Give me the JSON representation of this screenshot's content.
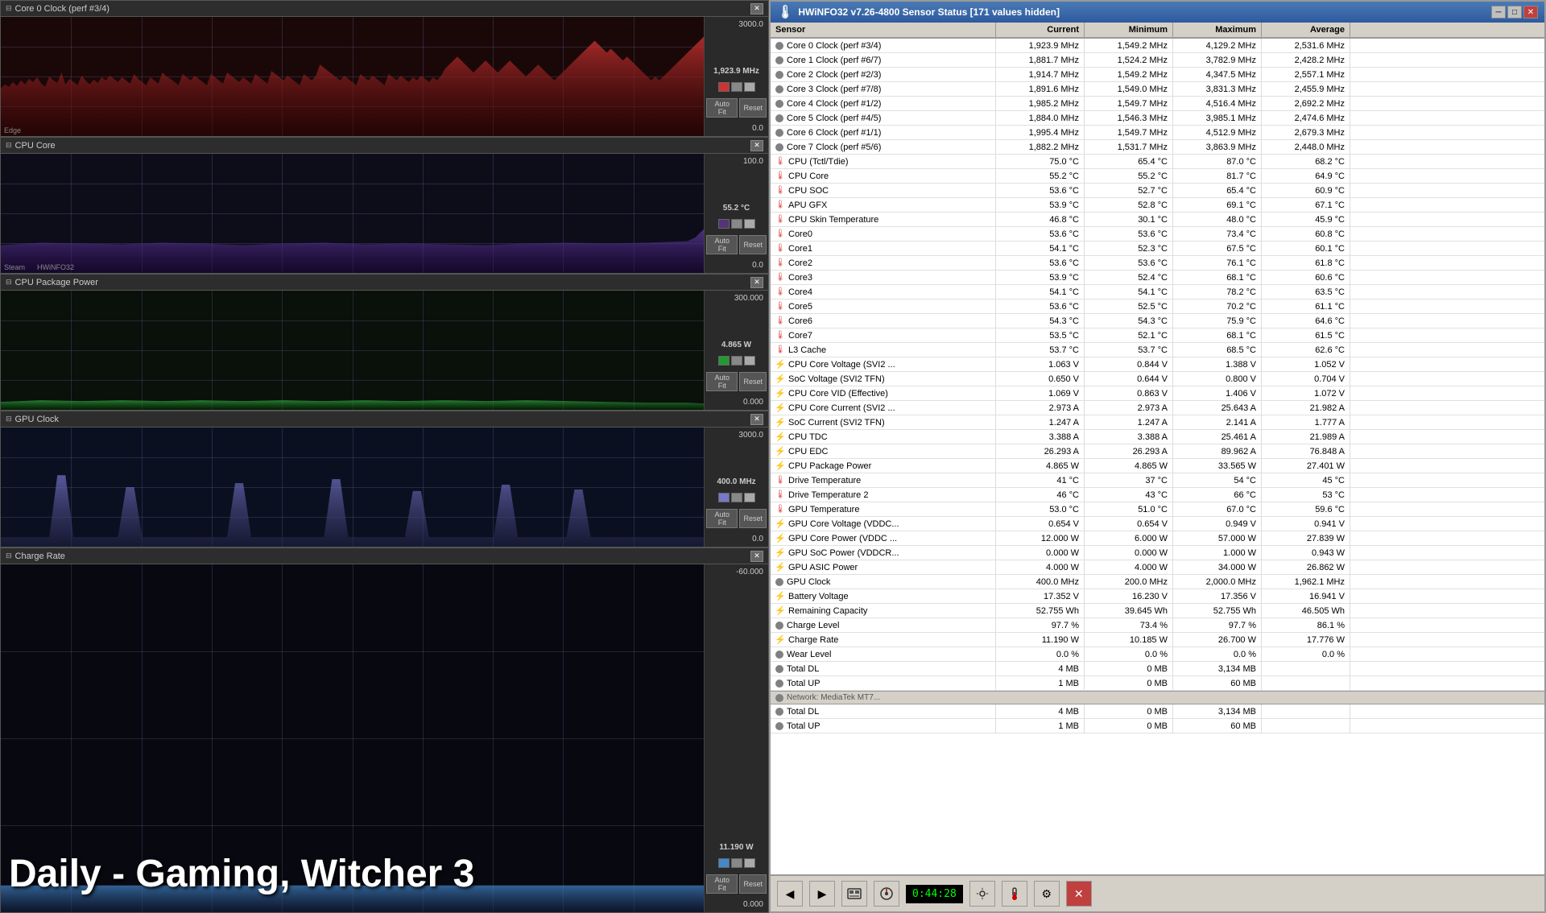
{
  "left_panel": {
    "charts": [
      {
        "id": "core0-clock",
        "title": "Core 0 Clock (perf #3/4)",
        "max_label": "3000.0",
        "current_label": "1,923.9 MHz",
        "min_label": "0.0",
        "color1": "#cc3333",
        "color2": "#888888",
        "color3": "#aaaaaa",
        "chart_type": "red_noisy"
      },
      {
        "id": "cpu-core",
        "title": "CPU Core",
        "max_label": "100.0",
        "current_label": "55.2 °C",
        "min_label": "0.0",
        "color1": "#553377",
        "color2": "#888888",
        "color3": "#aaaaaa",
        "chart_type": "purple_flat"
      },
      {
        "id": "cpu-power",
        "title": "CPU Package Power",
        "max_label": "300.000",
        "current_label": "4.865 W",
        "min_label": "0.000",
        "color1": "#229933",
        "color2": "#888888",
        "color3": "#aaaaaa",
        "chart_type": "green_flat"
      },
      {
        "id": "gpu-clock",
        "title": "GPU Clock",
        "max_label": "3000.0",
        "current_label": "400.0 MHz",
        "min_label": "0.0",
        "color1": "#7777cc",
        "color2": "#888888",
        "color3": "#aaaaaa",
        "chart_type": "blue_spiky"
      },
      {
        "id": "charge-rate",
        "title": "Charge Rate",
        "max_label": "-60.000",
        "current_label": "11.190 W",
        "min_label": "0.000",
        "color1": "#4488cc",
        "color2": "#888888",
        "color3": "#aaaaaa",
        "chart_type": "blue_flat"
      }
    ]
  },
  "bottom_text": "Daily - Gaming, Witcher 3",
  "taskbar": {
    "label1": "Edge",
    "label2": "Steam",
    "label3": "HWiNFO32"
  },
  "right_panel": {
    "title": "HWiNFO32 v7.26-4800 Sensor Status [171 values hidden]",
    "headers": [
      "Sensor",
      "Current",
      "Minimum",
      "Maximum",
      "Average"
    ],
    "rows": [
      {
        "icon": "circle",
        "name": "Core 0 Clock (perf #3/4)",
        "current": "1,923.9 MHz",
        "min": "1,549.2 MHz",
        "max": "4,129.2 MHz",
        "avg": "2,531.6 MHz"
      },
      {
        "icon": "circle",
        "name": "Core 1 Clock (perf #6/7)",
        "current": "1,881.7 MHz",
        "min": "1,524.2 MHz",
        "max": "3,782.9 MHz",
        "avg": "2,428.2 MHz"
      },
      {
        "icon": "circle",
        "name": "Core 2 Clock (perf #2/3)",
        "current": "1,914.7 MHz",
        "min": "1,549.2 MHz",
        "max": "4,347.5 MHz",
        "avg": "2,557.1 MHz"
      },
      {
        "icon": "circle",
        "name": "Core 3 Clock (perf #7/8)",
        "current": "1,891.6 MHz",
        "min": "1,549.0 MHz",
        "max": "3,831.3 MHz",
        "avg": "2,455.9 MHz"
      },
      {
        "icon": "circle",
        "name": "Core 4 Clock (perf #1/2)",
        "current": "1,985.2 MHz",
        "min": "1,549.7 MHz",
        "max": "4,516.4 MHz",
        "avg": "2,692.2 MHz"
      },
      {
        "icon": "circle",
        "name": "Core 5 Clock (perf #4/5)",
        "current": "1,884.0 MHz",
        "min": "1,546.3 MHz",
        "max": "3,985.1 MHz",
        "avg": "2,474.6 MHz"
      },
      {
        "icon": "circle",
        "name": "Core 6 Clock (perf #1/1)",
        "current": "1,995.4 MHz",
        "min": "1,549.7 MHz",
        "max": "4,512.9 MHz",
        "avg": "2,679.3 MHz"
      },
      {
        "icon": "circle",
        "name": "Core 7 Clock (perf #5/6)",
        "current": "1,882.2 MHz",
        "min": "1,531.7 MHz",
        "max": "3,863.9 MHz",
        "avg": "2,448.0 MHz"
      },
      {
        "icon": "thermo",
        "name": "CPU (Tctl/Tdie)",
        "current": "75.0 °C",
        "min": "65.4 °C",
        "max": "87.0 °C",
        "avg": "68.2 °C"
      },
      {
        "icon": "thermo",
        "name": "CPU Core",
        "current": "55.2 °C",
        "min": "55.2 °C",
        "max": "81.7 °C",
        "avg": "64.9 °C"
      },
      {
        "icon": "thermo",
        "name": "CPU SOC",
        "current": "53.6 °C",
        "min": "52.7 °C",
        "max": "65.4 °C",
        "avg": "60.9 °C"
      },
      {
        "icon": "thermo",
        "name": "APU GFX",
        "current": "53.9 °C",
        "min": "52.8 °C",
        "max": "69.1 °C",
        "avg": "67.1 °C"
      },
      {
        "icon": "thermo",
        "name": "CPU Skin Temperature",
        "current": "46.8 °C",
        "min": "30.1 °C",
        "max": "48.0 °C",
        "avg": "45.9 °C"
      },
      {
        "icon": "thermo",
        "name": "Core0",
        "current": "53.6 °C",
        "min": "53.6 °C",
        "max": "73.4 °C",
        "avg": "60.8 °C"
      },
      {
        "icon": "thermo",
        "name": "Core1",
        "current": "54.1 °C",
        "min": "52.3 °C",
        "max": "67.5 °C",
        "avg": "60.1 °C"
      },
      {
        "icon": "thermo",
        "name": "Core2",
        "current": "53.6 °C",
        "min": "53.6 °C",
        "max": "76.1 °C",
        "avg": "61.8 °C"
      },
      {
        "icon": "thermo",
        "name": "Core3",
        "current": "53.9 °C",
        "min": "52.4 °C",
        "max": "68.1 °C",
        "avg": "60.6 °C"
      },
      {
        "icon": "thermo",
        "name": "Core4",
        "current": "54.1 °C",
        "min": "54.1 °C",
        "max": "78.2 °C",
        "avg": "63.5 °C"
      },
      {
        "icon": "thermo",
        "name": "Core5",
        "current": "53.6 °C",
        "min": "52.5 °C",
        "max": "70.2 °C",
        "avg": "61.1 °C"
      },
      {
        "icon": "thermo",
        "name": "Core6",
        "current": "54.3 °C",
        "min": "54.3 °C",
        "max": "75.9 °C",
        "avg": "64.6 °C"
      },
      {
        "icon": "thermo",
        "name": "Core7",
        "current": "53.5 °C",
        "min": "52.1 °C",
        "max": "68.1 °C",
        "avg": "61.5 °C"
      },
      {
        "icon": "thermo",
        "name": "L3 Cache",
        "current": "53.7 °C",
        "min": "53.7 °C",
        "max": "68.5 °C",
        "avg": "62.6 °C"
      },
      {
        "icon": "lightning",
        "name": "CPU Core Voltage (SVI2 ...",
        "current": "1.063 V",
        "min": "0.844 V",
        "max": "1.388 V",
        "avg": "1.052 V"
      },
      {
        "icon": "lightning",
        "name": "SoC Voltage (SVI2 TFN)",
        "current": "0.650 V",
        "min": "0.644 V",
        "max": "0.800 V",
        "avg": "0.704 V"
      },
      {
        "icon": "lightning",
        "name": "CPU Core VID (Effective)",
        "current": "1.069 V",
        "min": "0.863 V",
        "max": "1.406 V",
        "avg": "1.072 V"
      },
      {
        "icon": "lightning",
        "name": "CPU Core Current (SVI2 ...",
        "current": "2.973 A",
        "min": "2.973 A",
        "max": "25.643 A",
        "avg": "21.982 A"
      },
      {
        "icon": "lightning",
        "name": "SoC Current (SVI2 TFN)",
        "current": "1.247 A",
        "min": "1.247 A",
        "max": "2.141 A",
        "avg": "1.777 A"
      },
      {
        "icon": "lightning",
        "name": "CPU TDC",
        "current": "3.388 A",
        "min": "3.388 A",
        "max": "25.461 A",
        "avg": "21.989 A"
      },
      {
        "icon": "lightning",
        "name": "CPU EDC",
        "current": "26.293 A",
        "min": "26.293 A",
        "max": "89.962 A",
        "avg": "76.848 A"
      },
      {
        "icon": "lightning",
        "name": "CPU Package Power",
        "current": "4.865 W",
        "min": "4.865 W",
        "max": "33.565 W",
        "avg": "27.401 W"
      },
      {
        "icon": "thermo",
        "name": "Drive Temperature",
        "current": "41 °C",
        "min": "37 °C",
        "max": "54 °C",
        "avg": "45 °C"
      },
      {
        "icon": "thermo",
        "name": "Drive Temperature 2",
        "current": "46 °C",
        "min": "43 °C",
        "max": "66 °C",
        "avg": "53 °C"
      },
      {
        "icon": "thermo",
        "name": "GPU Temperature",
        "current": "53.0 °C",
        "min": "51.0 °C",
        "max": "67.0 °C",
        "avg": "59.6 °C"
      },
      {
        "icon": "lightning",
        "name": "GPU Core Voltage (VDDC...",
        "current": "0.654 V",
        "min": "0.654 V",
        "max": "0.949 V",
        "avg": "0.941 V"
      },
      {
        "icon": "lightning",
        "name": "GPU Core Power (VDDC ...",
        "current": "12.000 W",
        "min": "6.000 W",
        "max": "57.000 W",
        "avg": "27.839 W"
      },
      {
        "icon": "lightning",
        "name": "GPU SoC Power (VDDCR...",
        "current": "0.000 W",
        "min": "0.000 W",
        "max": "1.000 W",
        "avg": "0.943 W"
      },
      {
        "icon": "lightning",
        "name": "GPU ASIC Power",
        "current": "4.000 W",
        "min": "4.000 W",
        "max": "34.000 W",
        "avg": "26.862 W"
      },
      {
        "icon": "circle",
        "name": "GPU Clock",
        "current": "400.0 MHz",
        "min": "200.0 MHz",
        "max": "2,000.0 MHz",
        "avg": "1,962.1 MHz"
      },
      {
        "icon": "lightning",
        "name": "Battery Voltage",
        "current": "17.352 V",
        "min": "16.230 V",
        "max": "17.356 V",
        "avg": "16.941 V"
      },
      {
        "icon": "lightning",
        "name": "Remaining Capacity",
        "current": "52.755 Wh",
        "min": "39.645 Wh",
        "max": "52.755 Wh",
        "avg": "46.505 Wh"
      },
      {
        "icon": "circle",
        "name": "Charge Level",
        "current": "97.7 %",
        "min": "73.4 %",
        "max": "97.7 %",
        "avg": "86.1 %"
      },
      {
        "icon": "lightning",
        "name": "Charge Rate",
        "current": "11.190 W",
        "min": "10.185 W",
        "max": "26.700 W",
        "avg": "17.776 W"
      },
      {
        "icon": "circle",
        "name": "Wear Level",
        "current": "0.0 %",
        "min": "0.0 %",
        "max": "0.0 %",
        "avg": "0.0 %"
      },
      {
        "icon": "separator",
        "name": "Network: MediaTek MT7...",
        "current": "",
        "min": "",
        "max": "",
        "avg": ""
      },
      {
        "icon": "circle",
        "name": "Total DL",
        "current": "4 MB",
        "min": "0 MB",
        "max": "3,134 MB",
        "avg": ""
      },
      {
        "icon": "circle",
        "name": "Total UP",
        "current": "1 MB",
        "min": "0 MB",
        "max": "60 MB",
        "avg": ""
      }
    ],
    "bottom_buttons": [
      "back",
      "forward",
      "hardware",
      "sensor",
      "settings",
      "thermal",
      "gear",
      "close"
    ],
    "clock": "0:44:28"
  }
}
